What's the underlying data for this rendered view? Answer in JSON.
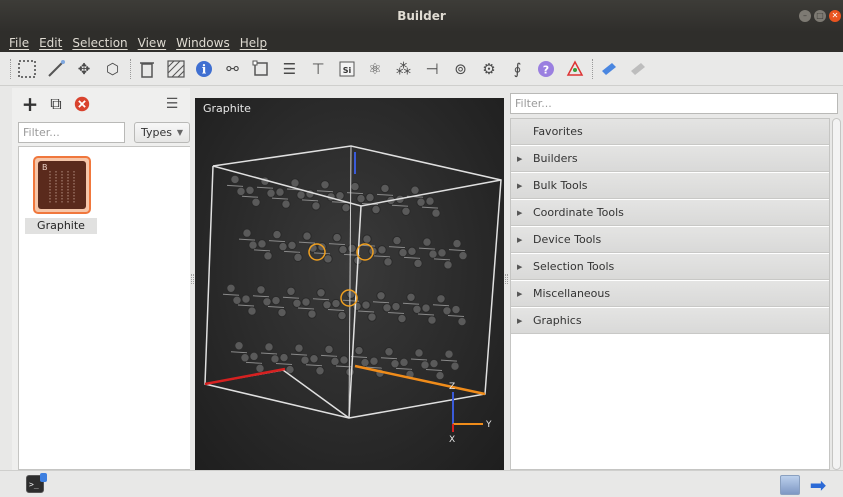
{
  "window": {
    "title": "Builder"
  },
  "menu": [
    "File",
    "Edit",
    "Selection",
    "View",
    "Windows",
    "Help"
  ],
  "left_panel": {
    "filter_placeholder": "Filter...",
    "types_label": "Types",
    "items": [
      {
        "label": "Graphite",
        "badge": "B"
      }
    ]
  },
  "viewport": {
    "title": "Graphite",
    "axes": {
      "x": "X",
      "y": "Y",
      "z": "Z"
    }
  },
  "right_panel": {
    "filter_placeholder": "Filter...",
    "tools": [
      "Favorites",
      "Builders",
      "Bulk Tools",
      "Coordinate Tools",
      "Device Tools",
      "Selection Tools",
      "Miscellaneous",
      "Graphics"
    ]
  },
  "statusbar": {
    "terminal_glyph": ">_"
  },
  "colors": {
    "accent": "#e95420",
    "selection": "#f0773c",
    "axis_x": "#d62020",
    "axis_y": "#f08c1a",
    "axis_z": "#3a5bd9"
  }
}
